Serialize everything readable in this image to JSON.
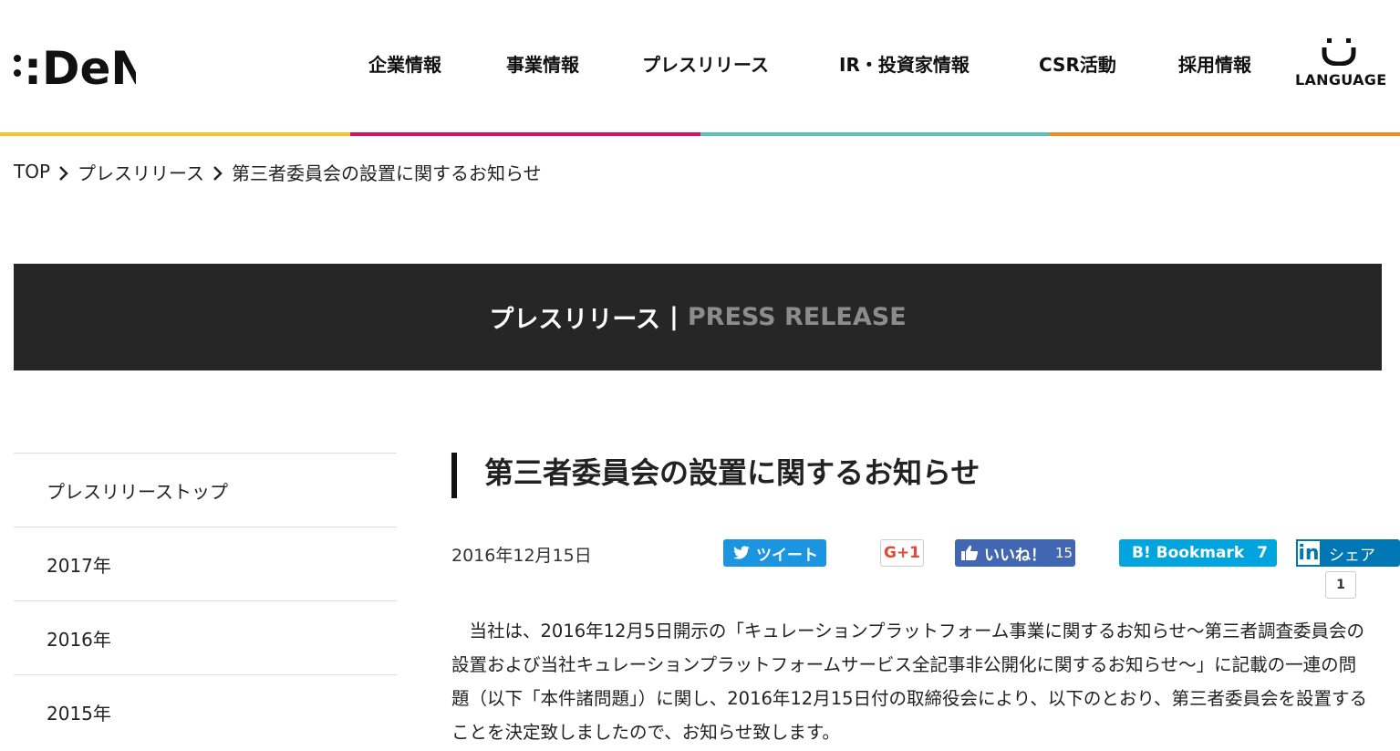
{
  "brand": {
    "logo_text": ":DeNA"
  },
  "nav": {
    "items": [
      "企業情報",
      "事業情報",
      "プレスリリース",
      "IR・投資家情報",
      "CSR活動",
      "採用情報"
    ],
    "language_label": "LANGUAGE"
  },
  "accent_colors": [
    "#f7c22c",
    "#d6135f",
    "#5bbfbd",
    "#f08a22"
  ],
  "breadcrumb": {
    "items": [
      "TOP",
      "プレスリリース"
    ],
    "current": "第三者委員会の設置に関するお知らせ"
  },
  "banner": {
    "title_jp": "プレスリリース",
    "divider": "|",
    "title_en": "PRESS RELEASE"
  },
  "sidebar": {
    "items": [
      "プレスリリーストップ",
      "2017年",
      "2016年",
      "2015年"
    ]
  },
  "article": {
    "title": "第三者委員会の設置に関するお知らせ",
    "date": "2016年12月15日",
    "body": "　当社は、2016年12月5日開示の「キュレーションプラットフォーム事業に関するお知らせ～第三者調査委員会の設置および当社キュレーションプラットフォームサービス全記事非公開化に関するお知らせ～」に記載の一連の問題（以下「本件諸問題」）に関し、2016年12月15日付の取締役会により、以下のとおり、第三者委員会を設置することを決定致しましたので、お知らせ致します。"
  },
  "share": {
    "tweet_label": "ツイート",
    "gplus_label": "G+1",
    "like_label": "いいね！",
    "like_count": "15",
    "hatena_label": "B! Bookmark",
    "hatena_count": "7",
    "linkedin_icon": "in",
    "linkedin_label": "シェア",
    "linkedin_count": "1"
  }
}
